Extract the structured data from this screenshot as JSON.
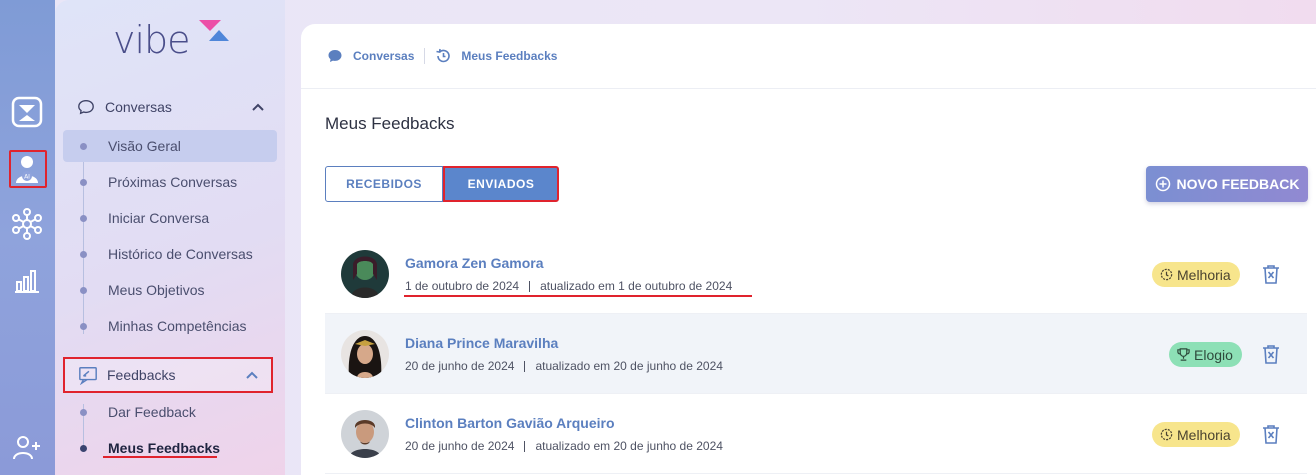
{
  "app": {
    "logo": "vibe"
  },
  "rail": {
    "icons": [
      "hourglass-icon",
      "ai-profile-icon",
      "network-icon",
      "bar-chart-icon",
      "add-user-icon"
    ]
  },
  "sidebar": {
    "conversas": {
      "label": "Conversas",
      "items": [
        {
          "label": "Visão Geral"
        },
        {
          "label": "Próximas Conversas"
        },
        {
          "label": "Iniciar Conversa"
        },
        {
          "label": "Histórico de Conversas"
        },
        {
          "label": "Meus Objetivos"
        },
        {
          "label": "Minhas Competências"
        }
      ]
    },
    "feedbacks": {
      "label": "Feedbacks",
      "items": [
        {
          "label": "Dar Feedback"
        },
        {
          "label": "Meus Feedbacks"
        }
      ]
    }
  },
  "breadcrumb": {
    "first": "Conversas",
    "second": "Meus Feedbacks"
  },
  "page": {
    "title": "Meus Feedbacks"
  },
  "tabs": {
    "received": "RECEBIDOS",
    "sent": "ENVIADOS",
    "active": "ENVIADOS"
  },
  "actions": {
    "new_feedback": "NOVO FEEDBACK"
  },
  "feedbacks": [
    {
      "name": "Gamora Zen Gamora",
      "date": "1 de outubro de 2024",
      "updated": "atualizado em 1 de outubro de 2024",
      "type": "Melhoria",
      "type_color": "#f7e58c"
    },
    {
      "name": "Diana Prince Maravilha",
      "date": "20 de junho de 2024",
      "updated": "atualizado em 20 de junho de 2024",
      "type": "Elogio",
      "type_color": "#8de0b6"
    },
    {
      "name": "Clinton Barton Gavião Arqueiro",
      "date": "20 de junho de 2024",
      "updated": "atualizado em 20 de junho de 2024",
      "type": "Melhoria",
      "type_color": "#f7e58c"
    }
  ],
  "colors": {
    "accent": "#5b7fbf",
    "highlight": "#e0232d"
  }
}
